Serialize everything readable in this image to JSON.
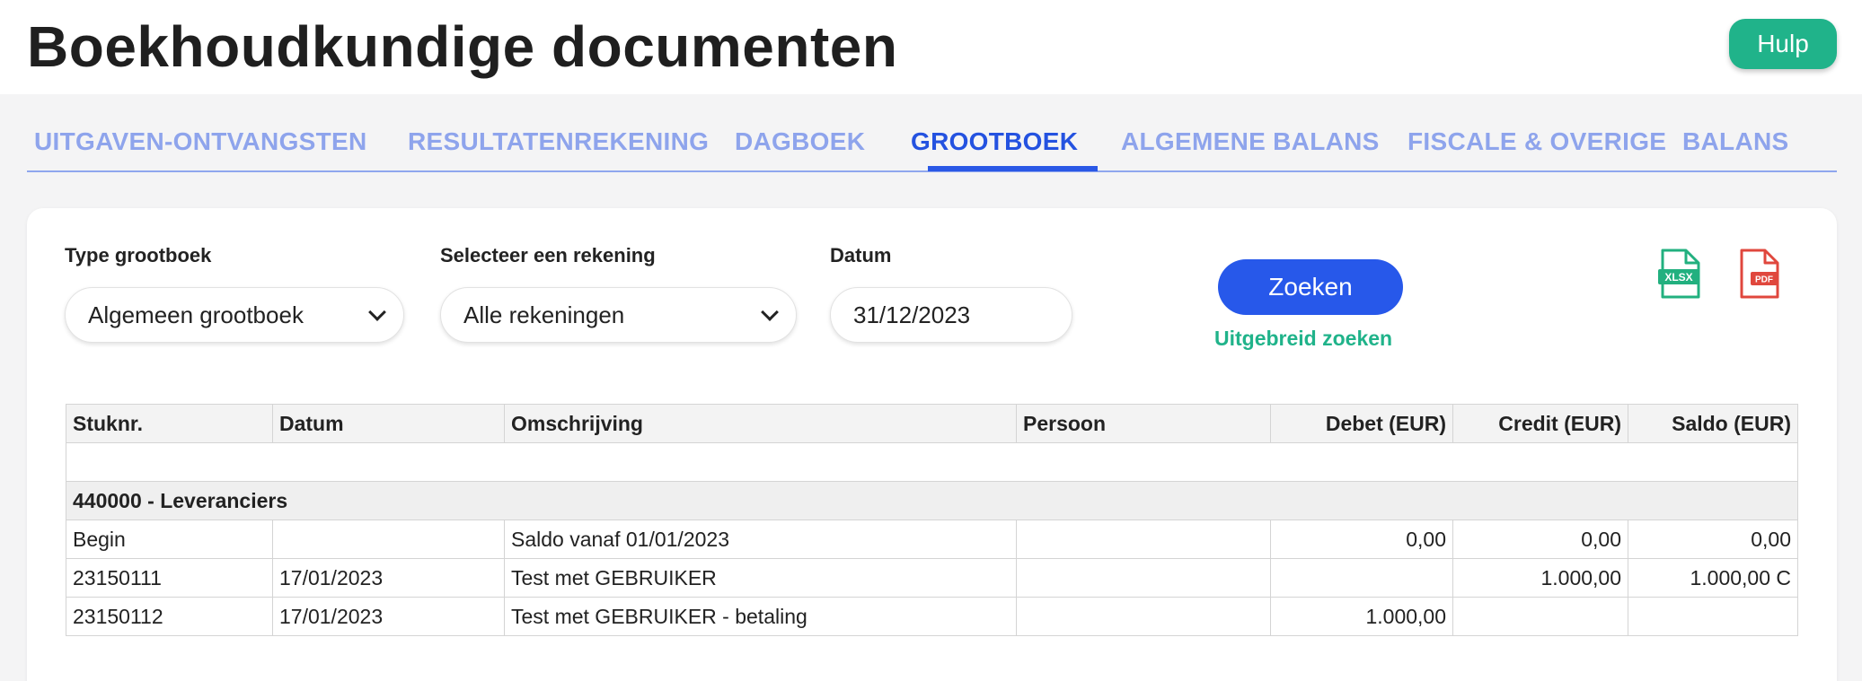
{
  "header": {
    "title": "Boekhoudkundige documenten",
    "help_label": "Hulp"
  },
  "tabs": [
    {
      "label": "UITGAVEN-ONTVANGSTEN",
      "active": false
    },
    {
      "label": "RESULTATENREKENING",
      "active": false
    },
    {
      "label": "DAGBOEK",
      "active": false
    },
    {
      "label": "GROOTBOEK",
      "active": true
    },
    {
      "label": "ALGEMENE BALANS",
      "active": false
    },
    {
      "label": "FISCALE & OVERIGE",
      "active": false
    },
    {
      "label": "BALANS",
      "active": false
    }
  ],
  "filters": {
    "type_label": "Type grootboek",
    "type_value": "Algemeen grootboek",
    "account_label": "Selecteer een rekening",
    "account_value": "Alle rekeningen",
    "date_label": "Datum",
    "date_value": "31/12/2023",
    "search_label": "Zoeken",
    "advanced_label": "Uitgebreid zoeken"
  },
  "exports": {
    "xlsx_label": "XLSX",
    "pdf_label": "PDF"
  },
  "colors": {
    "accent_blue": "#2758ea",
    "accent_green": "#20b38a",
    "pdf_red": "#e0473d",
    "tab_inactive": "#8ea4ec"
  },
  "icons": {
    "xlsx": "xlsx-file-icon",
    "pdf": "pdf-file-icon",
    "dropdown": "chevron-down-icon"
  },
  "table": {
    "columns": [
      "Stuknr.",
      "Datum",
      "Omschrijving",
      "Persoon",
      "Debet (EUR)",
      "Credit (EUR)",
      "Saldo (EUR)"
    ],
    "group_label": "440000 - Leveranciers",
    "rows": [
      [
        "Begin",
        "",
        "Saldo vanaf 01/01/2023",
        "",
        "0,00",
        "0,00",
        "0,00"
      ],
      [
        "23150111",
        "17/01/2023",
        "Test met GEBRUIKER",
        "",
        "",
        "1.000,00",
        "1.000,00 C"
      ],
      [
        "23150112",
        "17/01/2023",
        "Test met GEBRUIKER - betaling",
        "",
        "1.000,00",
        "",
        ""
      ]
    ]
  }
}
